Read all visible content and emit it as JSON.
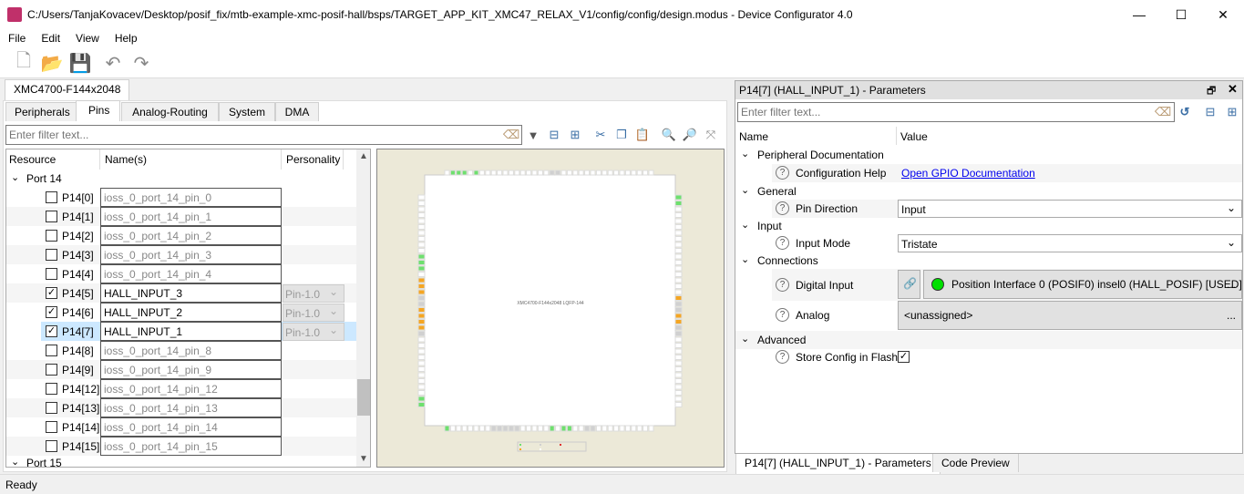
{
  "window": {
    "title": "C:/Users/TanjaKovacev/Desktop/posif_fix/mtb-example-xmc-posif-hall/bsps/TARGET_APP_KIT_XMC47_RELAX_V1/config/config/design.modus - Device Configurator 4.0",
    "minimize": "—",
    "maximize": "☐",
    "close": "✕"
  },
  "menu": [
    "File",
    "Edit",
    "View",
    "Help"
  ],
  "toolbar": {
    "icons": [
      "new-file-icon",
      "open-folder-icon",
      "save-icon",
      "undo-icon",
      "redo-icon"
    ]
  },
  "left": {
    "device_tab": "XMC4700-F144x2048",
    "tabs": [
      "Peripherals",
      "Pins",
      "Analog-Routing",
      "System",
      "DMA"
    ],
    "selected_tab": "Pins",
    "filter_placeholder": "Enter filter text...",
    "columns": [
      "Resource",
      "Name(s)",
      "Personality"
    ],
    "port14": "Port 14",
    "port15": "Port 15",
    "rows": [
      {
        "label": "P14[0]",
        "name": "ioss_0_port_14_pin_0",
        "checked": false
      },
      {
        "label": "P14[1]",
        "name": "ioss_0_port_14_pin_1",
        "checked": false
      },
      {
        "label": "P14[2]",
        "name": "ioss_0_port_14_pin_2",
        "checked": false
      },
      {
        "label": "P14[3]",
        "name": "ioss_0_port_14_pin_3",
        "checked": false
      },
      {
        "label": "P14[4]",
        "name": "ioss_0_port_14_pin_4",
        "checked": false
      },
      {
        "label": "P14[5]",
        "name": "HALL_INPUT_3",
        "checked": true,
        "personality": "Pin-1.0"
      },
      {
        "label": "P14[6]",
        "name": "HALL_INPUT_2",
        "checked": true,
        "personality": "Pin-1.0"
      },
      {
        "label": "P14[7]",
        "name": "HALL_INPUT_1",
        "checked": true,
        "personality": "Pin-1.0",
        "selected": true
      },
      {
        "label": "P14[8]",
        "name": "ioss_0_port_14_pin_8",
        "checked": false
      },
      {
        "label": "P14[9]",
        "name": "ioss_0_port_14_pin_9",
        "checked": false
      },
      {
        "label": "P14[12]",
        "name": "ioss_0_port_14_pin_12",
        "checked": false
      },
      {
        "label": "P14[13]",
        "name": "ioss_0_port_14_pin_13",
        "checked": false
      },
      {
        "label": "P14[14]",
        "name": "ioss_0_port_14_pin_14",
        "checked": false
      },
      {
        "label": "P14[15]",
        "name": "ioss_0_port_14_pin_15",
        "checked": false
      }
    ],
    "chip_label": "XMC4700-F144x2048 LQFP-144",
    "chip_colors": {
      "assigned": "#6ee06e",
      "reserved": "#f5a623",
      "fixed": "#d0d0d0",
      "error": "#e03030",
      "free": "#ffffff"
    }
  },
  "right": {
    "title": "P14[7] (HALL_INPUT_1) - Parameters",
    "filter_placeholder": "Enter filter text...",
    "columns": [
      "Name",
      "Value"
    ],
    "cat_doc": "Peripheral Documentation",
    "config_help": "Configuration Help",
    "config_help_link": "Open GPIO Documentation",
    "cat_general": "General",
    "pin_direction": "Pin Direction",
    "pin_direction_value": "Input",
    "cat_input": "Input",
    "input_mode": "Input Mode",
    "input_mode_value": "Tristate",
    "cat_connections": "Connections",
    "digital_input": "Digital Input",
    "digital_input_value": "Position Interface 0 (POSIF0) insel0 (HALL_POSIF) [USED]",
    "analog": "Analog",
    "analog_value": "<unassigned>",
    "ellipsis": "...",
    "cat_advanced": "Advanced",
    "store_config": "Store Config in Flash",
    "store_config_checked": true,
    "bottom_tabs": [
      "P14[7] (HALL_INPUT_1) - Parameters",
      "Code Preview"
    ]
  },
  "status": "Ready"
}
